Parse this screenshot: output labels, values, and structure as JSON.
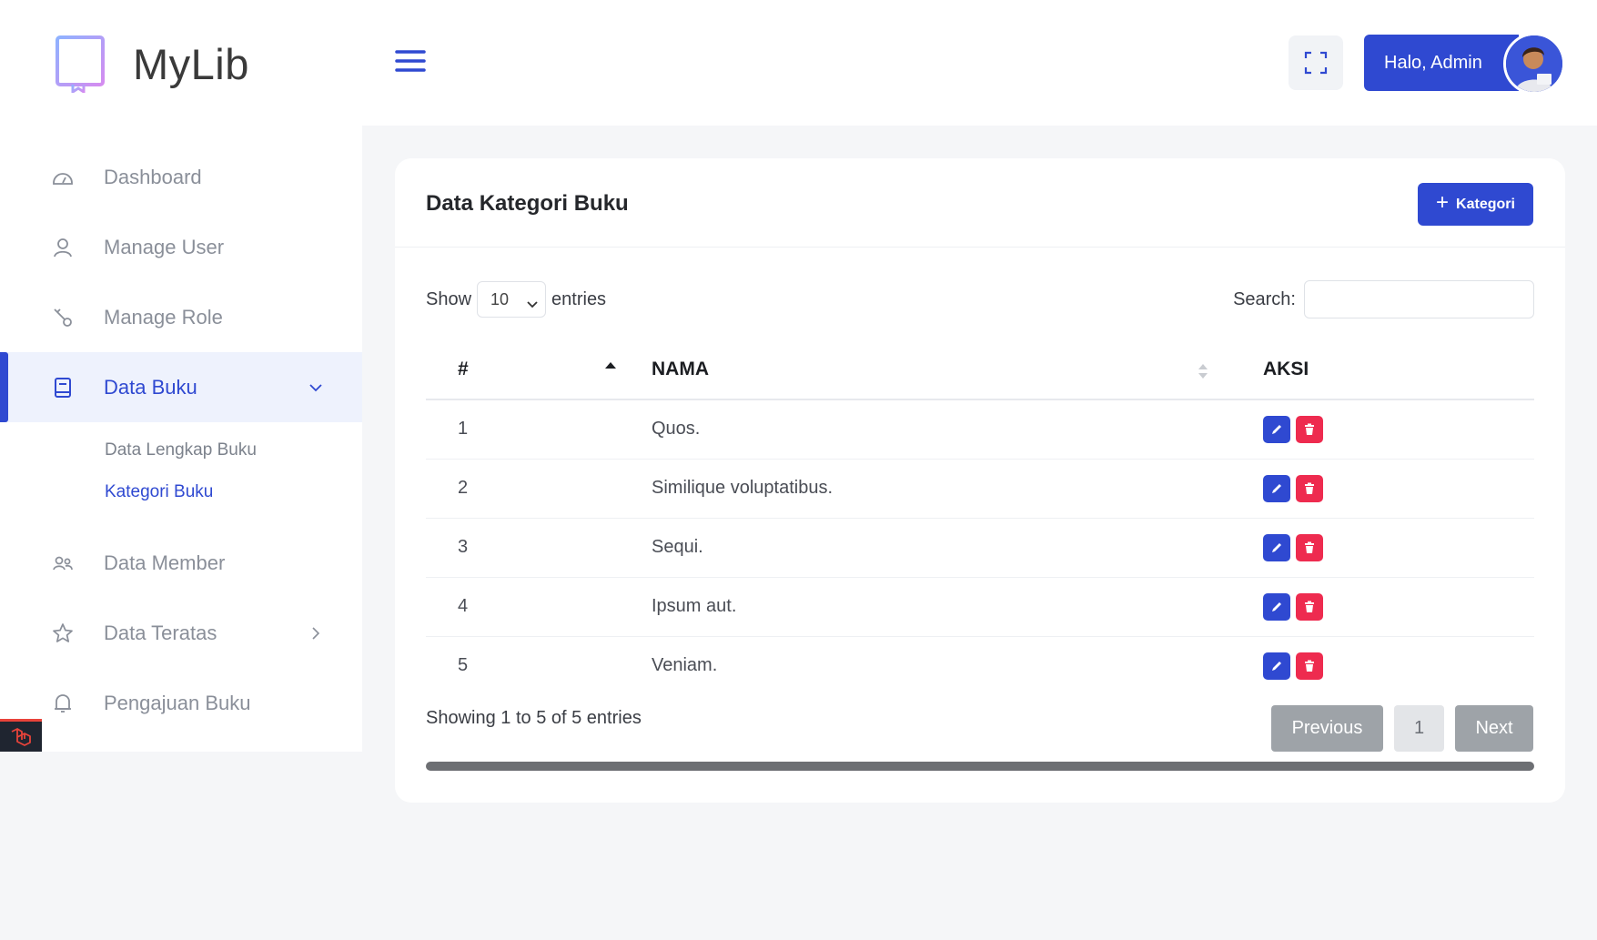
{
  "brand": {
    "name": "MyLib"
  },
  "sidebar": {
    "items": [
      {
        "label": "Dashboard",
        "icon": "dashboard-gauge-icon"
      },
      {
        "label": "Manage User",
        "icon": "user-icon"
      },
      {
        "label": "Manage Role",
        "icon": "key-icon"
      },
      {
        "label": "Data Buku",
        "icon": "book-icon",
        "active": true,
        "expanded": true,
        "children": [
          {
            "label": "Data Lengkap Buku"
          },
          {
            "label": "Kategori Buku",
            "active": true
          }
        ]
      },
      {
        "label": "Data Member",
        "icon": "users-icon"
      },
      {
        "label": "Data Teratas",
        "icon": "star-icon",
        "has_children": true
      },
      {
        "label": "Pengajuan Buku",
        "icon": "bell-icon"
      }
    ]
  },
  "topbar": {
    "user_label": "Halo, Admin"
  },
  "card": {
    "title": "Data Kategori Buku",
    "add_button": "Kategori",
    "show_label": "Show",
    "entries_value": "10",
    "entries_label": "entries",
    "search_label": "Search:",
    "search_value": ""
  },
  "table": {
    "headers": [
      "#",
      "NAMA",
      "AKSI"
    ],
    "rows": [
      {
        "num": "1",
        "nama": "Quos."
      },
      {
        "num": "2",
        "nama": "Similique voluptatibus."
      },
      {
        "num": "3",
        "nama": "Sequi."
      },
      {
        "num": "4",
        "nama": "Ipsum aut."
      },
      {
        "num": "5",
        "nama": "Veniam."
      }
    ]
  },
  "footer": {
    "info": "Showing 1 to 5 of 5 entries",
    "previous": "Previous",
    "page": "1",
    "next": "Next"
  },
  "colors": {
    "primary": "#2f49d1",
    "danger": "#ee2b4f",
    "muted": "#9ea3a8"
  }
}
